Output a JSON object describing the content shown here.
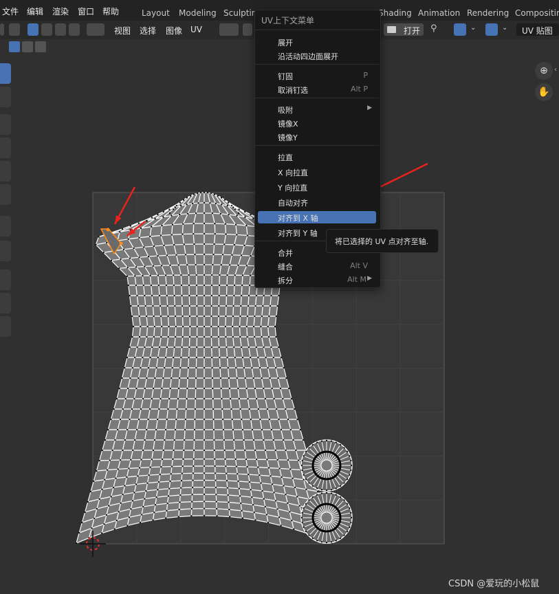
{
  "topbar": {
    "menus": [
      "文件",
      "编辑",
      "渲染",
      "窗口",
      "帮助"
    ],
    "workspace_tabs": [
      "Layout",
      "Modeling",
      "Sculpting",
      "Shading",
      "Animation",
      "Rendering",
      "Compositing"
    ]
  },
  "header": {
    "view_label": "视图",
    "select_label": "选择",
    "image_label": "图像",
    "uv_label": "UV",
    "open_label": "打开",
    "uv_map_label": "UV 贴图"
  },
  "context_menu": {
    "title": "UV上下文菜单",
    "items": [
      {
        "label": "展开",
        "shortcut": ""
      },
      {
        "label": "沿活动四边面展开",
        "shortcut": ""
      },
      {
        "label": "钉固",
        "shortcut": "P"
      },
      {
        "label": "取消钉选",
        "shortcut": "Alt P"
      },
      {
        "label": "吸附",
        "shortcut": "",
        "submenu": true
      },
      {
        "label": "镜像X",
        "shortcut": ""
      },
      {
        "label": "镜像Y",
        "shortcut": ""
      },
      {
        "label": "拉直",
        "shortcut": ""
      },
      {
        "label": "X 向拉直",
        "shortcut": ""
      },
      {
        "label": "Y 向拉直",
        "shortcut": ""
      },
      {
        "label": "自动对齐",
        "shortcut": ""
      },
      {
        "label": "对齐到 X 轴",
        "shortcut": "",
        "highlighted": true
      },
      {
        "label": "对齐到 Y 轴",
        "shortcut": ""
      },
      {
        "label": "合并",
        "shortcut": ""
      },
      {
        "label": "缝合",
        "shortcut": "Alt V"
      },
      {
        "label": "拆分",
        "shortcut": "Alt M",
        "submenu": true
      }
    ]
  },
  "tooltip": {
    "text": "将已选择的 UV 点对齐至轴."
  },
  "watermark": "CSDN @爱玩的小松鼠",
  "colors": {
    "accent": "#4772b3",
    "selected_edge": "#ff8c1a",
    "annotation_arrow": "#e8231e",
    "uv_face": "#7a7a7a",
    "cursor_ring": "#e03030"
  },
  "icons": [
    "zoom-icon",
    "hand-pan-icon",
    "pin-icon",
    "folder-icon",
    "cursor-3d-icon"
  ]
}
